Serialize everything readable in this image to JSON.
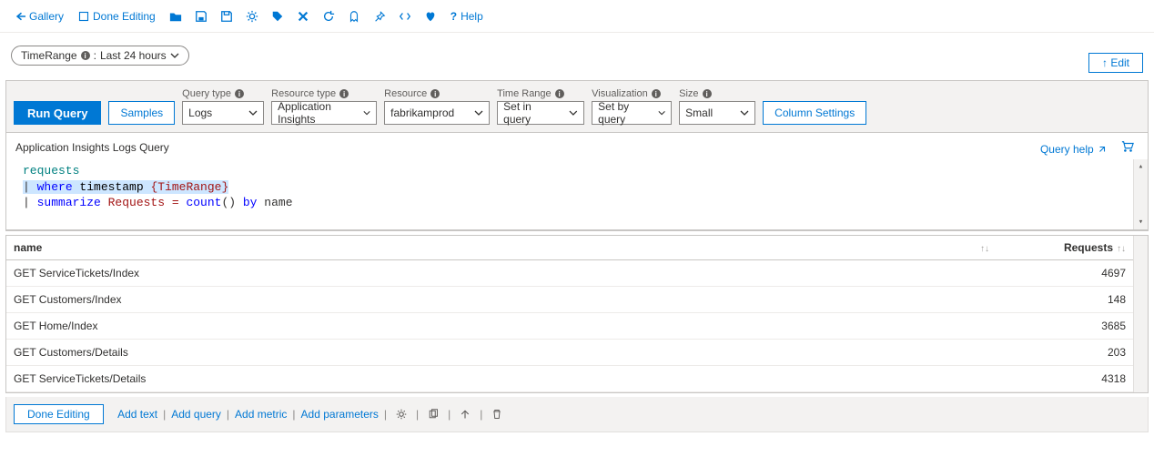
{
  "toolbar": {
    "back_gallery": "Gallery",
    "done_editing": "Done Editing",
    "help": "Help"
  },
  "param": {
    "label": "TimeRange",
    "value": "Last 24 hours"
  },
  "edit_btn": "↑ Edit",
  "controls": {
    "run_query": "Run Query",
    "samples": "Samples",
    "column_settings": "Column Settings",
    "query_type": {
      "label": "Query type",
      "value": "Logs"
    },
    "resource_type": {
      "label": "Resource type",
      "value": "Application Insights"
    },
    "resource": {
      "label": "Resource",
      "value": "fabrikamprod"
    },
    "time_range": {
      "label": "Time Range",
      "value": "Set in query"
    },
    "visualization": {
      "label": "Visualization",
      "value": "Set by query"
    },
    "size": {
      "label": "Size",
      "value": "Small"
    }
  },
  "query_title": "Application Insights Logs Query",
  "query_help": "Query help",
  "editor": {
    "line1": "requests",
    "line2_pipe": "| ",
    "line2_where": "where",
    "line2_ts": " timestamp ",
    "line2_tr": "{TimeRange}",
    "line3_pipe": "| ",
    "line3_sum": "summarize",
    "line3_eq": " Requests = ",
    "line3_count": "count",
    "line3_paren": "() ",
    "line3_by": "by",
    "line3_name": " name"
  },
  "table": {
    "col_name": "name",
    "col_requests": "Requests",
    "rows": [
      {
        "name": "GET ServiceTickets/Index",
        "requests": "4697"
      },
      {
        "name": "GET Customers/Index",
        "requests": "148"
      },
      {
        "name": "GET Home/Index",
        "requests": "3685"
      },
      {
        "name": "GET Customers/Details",
        "requests": "203"
      },
      {
        "name": "GET ServiceTickets/Details",
        "requests": "4318"
      }
    ]
  },
  "footer": {
    "done": "Done Editing",
    "add_text": "Add text",
    "add_query": "Add query",
    "add_metric": "Add metric",
    "add_params": "Add parameters"
  }
}
